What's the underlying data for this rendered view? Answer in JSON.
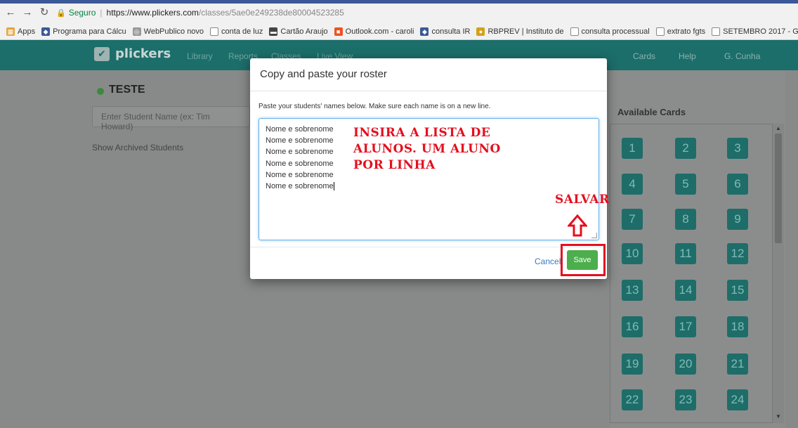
{
  "browser": {
    "lock_label": "Seguro",
    "url_host": "https://www.plickers.com",
    "url_path": "/classes/5ae0e249238de80004523285",
    "bookmarks": [
      {
        "label": "Apps",
        "icon": "apps-grid-icon",
        "color": "#e8a33d"
      },
      {
        "label": "Programa para Cálcu",
        "icon": "site-icon",
        "color": "#3b5998"
      },
      {
        "label": "WebPublico novo",
        "icon": "globe-icon",
        "color": "#999999"
      },
      {
        "label": "conta de luz",
        "icon": "page-icon",
        "color": "#ffffff"
      },
      {
        "label": "Cartão Araujo",
        "icon": "card-icon",
        "color": "#444444"
      },
      {
        "label": "Outlook.com - caroli",
        "icon": "outlook-icon",
        "color": "#f25022"
      },
      {
        "label": "consulta IR",
        "icon": "site-icon",
        "color": "#3b5998"
      },
      {
        "label": "RBPREV | Instituto de",
        "icon": "rbprev-icon",
        "color": "#d4a017"
      },
      {
        "label": "consulta processual",
        "icon": "page-icon",
        "color": "#ffffff"
      },
      {
        "label": "extrato fgts",
        "icon": "page-icon",
        "color": "#ffffff"
      },
      {
        "label": "SETEMBRO 2017 - G",
        "icon": "page-icon",
        "color": "#ffffff"
      }
    ]
  },
  "app": {
    "logo": "plickers",
    "nav": [
      "Library",
      "Reports",
      "Classes",
      "Live View"
    ],
    "nav_right": [
      "Cards",
      "Help",
      "G. Cunha"
    ],
    "class_name": "TESTE",
    "student_placeholder": "Enter Student Name (ex: Tim Howard)",
    "archived_link": "Show Archived Students",
    "cards_title": "Available Cards",
    "cards": [
      "1",
      "2",
      "3",
      "4",
      "5",
      "6",
      "7",
      "8",
      "9",
      "10",
      "11",
      "12",
      "13",
      "14",
      "15",
      "16",
      "17",
      "18",
      "19",
      "20",
      "21",
      "22",
      "23",
      "24"
    ]
  },
  "modal": {
    "title": "Copy and paste your roster",
    "instructions": "Paste your students' names below. Make sure each name is on a new line.",
    "roster_lines": [
      "Nome e sobrenome",
      "Nome e sobrenome",
      "Nome e sobrenome",
      "Nome e sobrenome",
      "Nome e sobrenome",
      "Nome e sobrenome"
    ],
    "cancel": "Cancel",
    "save": "Save"
  },
  "annotations": {
    "main": "INSIRA A LISTA DE ALUNOS. UM ALUNO POR LINHA",
    "main_lines": [
      "INSIRA A LISTA DE",
      "ALUNOS. UM ALUNO",
      "POR LINHA"
    ],
    "save_label": "SALVAR",
    "color": "#e3101e"
  }
}
